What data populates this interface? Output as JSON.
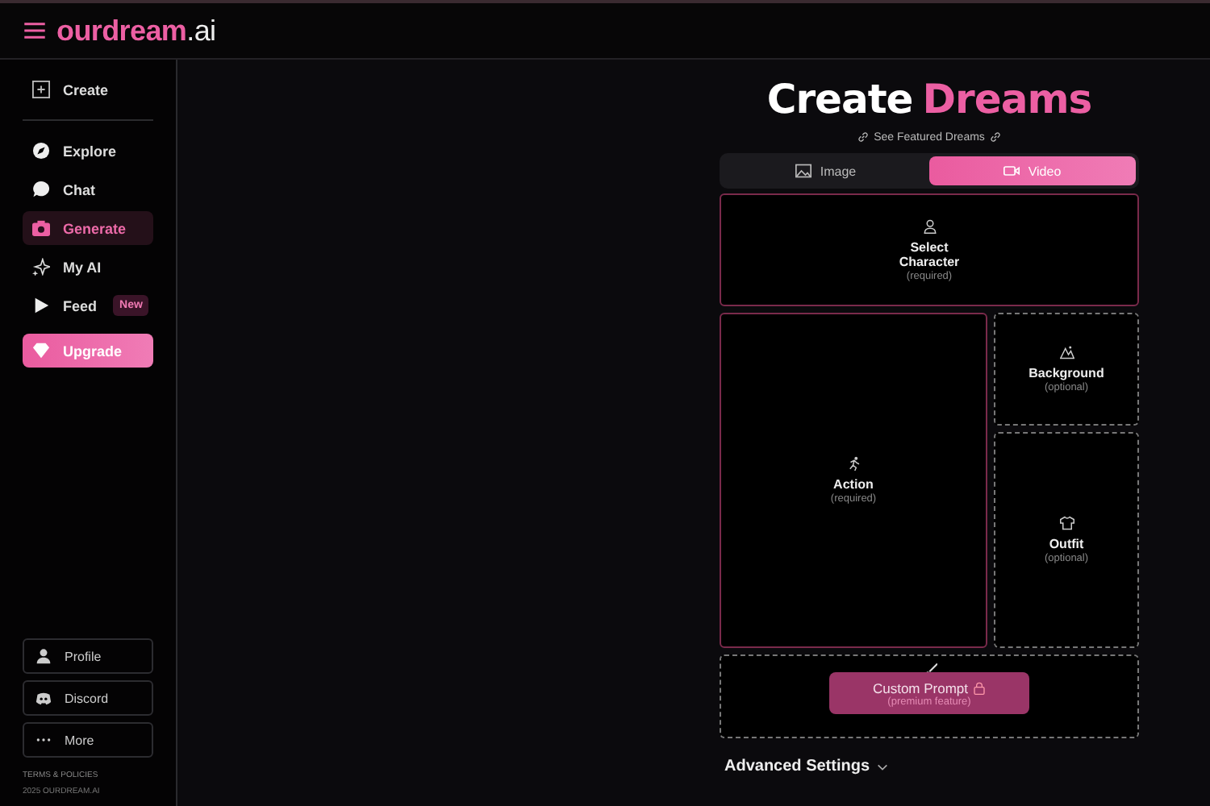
{
  "header": {
    "logo_main": "ourdream",
    "logo_suffix": ".ai"
  },
  "sidebar": {
    "create": "Create",
    "items": [
      {
        "kind": "compass",
        "label": "Explore",
        "selected": false
      },
      {
        "kind": "chat",
        "label": "Chat",
        "selected": false
      },
      {
        "kind": "camera",
        "label": "Generate",
        "selected": true
      },
      {
        "kind": "sparkle",
        "label": "My AI",
        "selected": false
      },
      {
        "kind": "play",
        "label": "Feed",
        "selected": false,
        "badge": "New"
      }
    ],
    "upgrade": "Upgrade",
    "bottom_items": [
      {
        "kind": "person",
        "label": "Profile"
      },
      {
        "kind": "discord",
        "label": "Discord"
      },
      {
        "kind": "dots",
        "label": "More"
      }
    ],
    "footer": [
      "TERMS & POLICIES",
      "2025 OURDREAM.AI"
    ]
  },
  "main": {
    "title_start": "Create",
    "title_accent": "Dreams",
    "featured_link": "See Featured Dreams",
    "tabs": [
      {
        "kind": "image",
        "label": "Image",
        "selected": false
      },
      {
        "kind": "video",
        "label": "Video",
        "selected": true
      }
    ],
    "slots": [
      {
        "kind": "character",
        "title": "Select Character",
        "note": "(required)",
        "required": true
      },
      {
        "kind": "action",
        "title": "Action",
        "note": "(required)",
        "required": true
      },
      {
        "kind": "background",
        "title": "Background",
        "note": "(optional)",
        "required": false
      },
      {
        "kind": "outfit",
        "title": "Outfit",
        "note": "(optional)",
        "required": false
      }
    ],
    "prompt": {
      "button": "Custom Prompt",
      "note": "(premium feature)"
    },
    "advanced": "Advanced Settings"
  }
}
